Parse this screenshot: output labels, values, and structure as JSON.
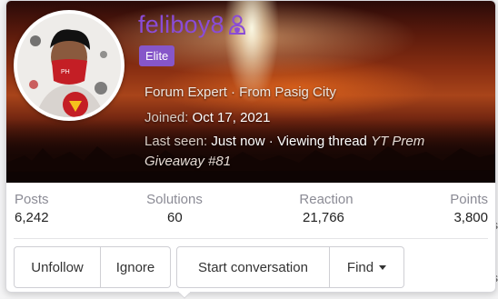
{
  "profile": {
    "username": "feliboy8",
    "username_icon": "user-shield-icon",
    "badge": "Elite",
    "title_line": "Forum Expert · From Pasig City",
    "joined_label": "Joined:",
    "joined_value": "Oct 17, 2021",
    "last_seen_label": "Last seen:",
    "last_seen_value": "Just now",
    "activity_sep": "·",
    "activity_label": "Viewing thread",
    "thread_title_line1": "YT Prem",
    "thread_title_line2": "Giveaway #81",
    "accent_color": "#8a4cd6",
    "badge_color": "#8656c9"
  },
  "stats": [
    {
      "label": "Posts",
      "value": "6,242"
    },
    {
      "label": "Solutions",
      "value": "60"
    },
    {
      "label": "Reaction",
      "value": "21,766"
    },
    {
      "label": "Points",
      "value": "3,800"
    }
  ],
  "actions": {
    "unfollow": "Unfollow",
    "ignore": "Ignore",
    "start_conversation": "Start conversation",
    "find": "Find"
  },
  "background": {
    "glyph_1": "s",
    "glyph_2": "s"
  }
}
